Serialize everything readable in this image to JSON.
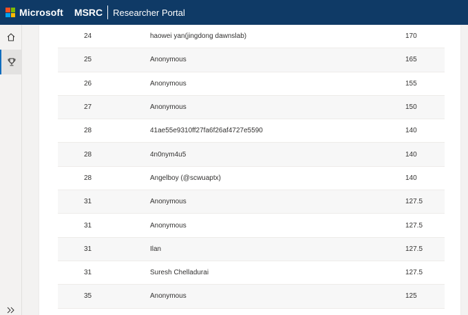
{
  "header": {
    "brand": "Microsoft",
    "product": "MSRC",
    "portal": "Researcher Portal",
    "colors": {
      "bar": "#0f3a66",
      "logo": [
        "#f25022",
        "#7fba00",
        "#00a4ef",
        "#ffb900"
      ]
    }
  },
  "sidebar": {
    "items": [
      {
        "icon": "home-icon",
        "active": false
      },
      {
        "icon": "trophy-icon",
        "active": true
      }
    ],
    "expand_icon": "double-chevron-right-icon"
  },
  "leaderboard": {
    "rows": [
      {
        "rank": "24",
        "name": "haowei yan(jingdong dawnslab)",
        "points": "170"
      },
      {
        "rank": "25",
        "name": "Anonymous",
        "points": "165"
      },
      {
        "rank": "26",
        "name": "Anonymous",
        "points": "155"
      },
      {
        "rank": "27",
        "name": "Anonymous",
        "points": "150"
      },
      {
        "rank": "28",
        "name": "41ae55e9310ff27fa6f26af4727e5590",
        "points": "140"
      },
      {
        "rank": "28",
        "name": "4n0nym4u5",
        "points": "140"
      },
      {
        "rank": "28",
        "name": "Angelboy (@scwuaptx)",
        "points": "140"
      },
      {
        "rank": "31",
        "name": "Anonymous",
        "points": "127.5"
      },
      {
        "rank": "31",
        "name": "Anonymous",
        "points": "127.5"
      },
      {
        "rank": "31",
        "name": "Ilan",
        "points": "127.5"
      },
      {
        "rank": "31",
        "name": "Suresh Chelladurai",
        "points": "127.5"
      },
      {
        "rank": "35",
        "name": "Anonymous",
        "points": "125"
      }
    ]
  }
}
